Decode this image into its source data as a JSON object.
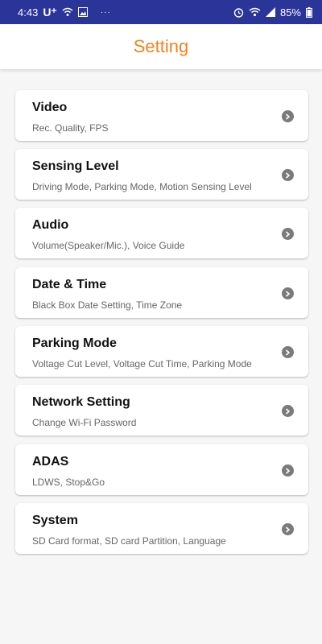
{
  "status_bar": {
    "time": "4:43",
    "carrier": "U⁺",
    "battery_text": "85%",
    "overflow": "···"
  },
  "header": {
    "title": "Setting"
  },
  "settings": [
    {
      "title": "Video",
      "subtitle": "Rec. Quality, FPS"
    },
    {
      "title": "Sensing Level",
      "subtitle": "Driving Mode, Parking Mode, Motion Sensing Level"
    },
    {
      "title": "Audio",
      "subtitle": "Volume(Speaker/Mic.), Voice Guide"
    },
    {
      "title": "Date & Time",
      "subtitle": "Black Box Date Setting, Time Zone"
    },
    {
      "title": "Parking Mode",
      "subtitle": "Voltage Cut Level, Voltage Cut Time, Parking Mode"
    },
    {
      "title": "Network Setting",
      "subtitle": "Change Wi-Fi Password"
    },
    {
      "title": "ADAS",
      "subtitle": "LDWS, Stop&Go"
    },
    {
      "title": "System",
      "subtitle": "SD Card format, SD card Partition, Language"
    }
  ],
  "colors": {
    "accent": "#f5811f",
    "status_bar": "#2b3499"
  },
  "icons": {
    "chevron": "chevron-right-icon"
  }
}
